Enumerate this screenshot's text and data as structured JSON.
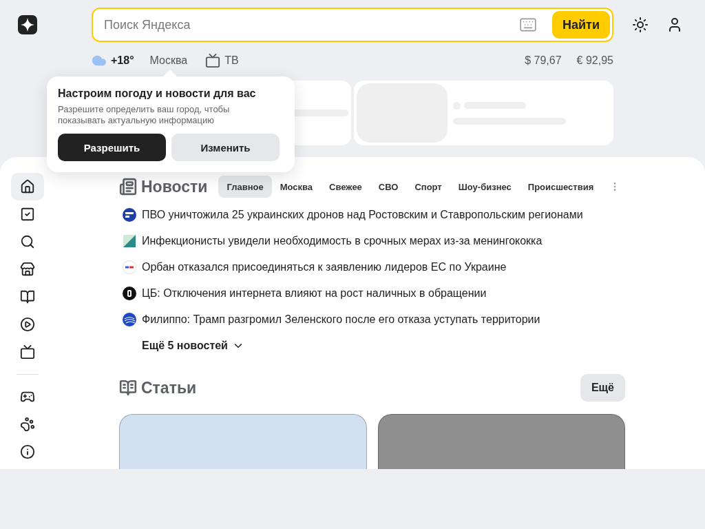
{
  "header": {
    "search": {
      "placeholder": "Поиск Яндекса"
    },
    "search_button": "Найти"
  },
  "info_bar": {
    "temperature": "+18°",
    "city": "Москва",
    "tv": "ТВ",
    "currency": [
      "$ 79,67",
      "€ 92,95"
    ]
  },
  "popup": {
    "title": "Настроим погоду и новости для вас",
    "text": "Разрешите определить ваш город, чтобы показывать актуальную информацию",
    "buttons": [
      {
        "label": "Разрешить",
        "kind": "primary"
      },
      {
        "label": "Изменить",
        "kind": "secondary"
      }
    ]
  },
  "sidebar": {
    "groups": [
      [
        {
          "kind": "home",
          "selected": true
        },
        {
          "kind": "tasks",
          "selected": false
        },
        {
          "kind": "search",
          "selected": false
        },
        {
          "kind": "market",
          "selected": false
        },
        {
          "kind": "reader",
          "selected": false
        },
        {
          "kind": "video",
          "selected": false
        },
        {
          "kind": "tv",
          "selected": false
        }
      ],
      [
        {
          "kind": "games",
          "selected": false
        },
        {
          "kind": "kids",
          "selected": false
        },
        {
          "kind": "info",
          "selected": false
        }
      ]
    ]
  },
  "news": {
    "title": "Новости",
    "tabs": [
      {
        "label": "Главное",
        "selected": true
      },
      {
        "label": "Москва",
        "selected": false
      },
      {
        "label": "Свежее",
        "selected": false
      },
      {
        "label": "СВО",
        "selected": false
      },
      {
        "label": "Спорт",
        "selected": false
      },
      {
        "label": "Шоу-бизнес",
        "selected": false
      },
      {
        "label": "Происшествия",
        "selected": false
      }
    ],
    "items": [
      {
        "kind": "blue",
        "text": "ПВО уничтожила 25 украинских дронов над Ростовским и Ставропольским регионами"
      },
      {
        "kind": "diagonal",
        "text": "Инфекционисты увидели необходимость в срочных мерах из-за менингококка"
      },
      {
        "kind": "light",
        "text": "Орбан отказался присоединяться к заявлению лидеров ЕС по Украине"
      },
      {
        "kind": "dark",
        "text": "ЦБ: Отключения интернета влияют на рост наличных в обращении"
      },
      {
        "kind": "globe",
        "text": "Филиппо: Трамп разгромил Зеленского после его отказа уступать территории"
      }
    ],
    "more": "Ещё 5 новостей"
  },
  "articles": {
    "title": "Статьи",
    "more_button": "Ещё",
    "cards": [
      {
        "color": "#d2e0f0"
      },
      {
        "color": "#8f8f8f"
      }
    ]
  }
}
